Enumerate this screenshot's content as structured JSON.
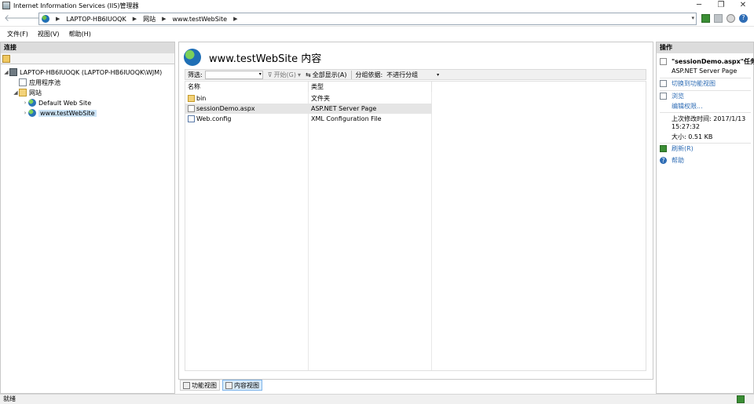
{
  "window": {
    "title": "Internet Information Services (IIS)管理器",
    "min": "─",
    "max": "❐",
    "close": "✕"
  },
  "nav": {
    "back": "🡐",
    "forward": "🡒"
  },
  "address": {
    "crumbs": [
      "LAPTOP-HB6IUOQK",
      "网站",
      "www.testWebSite"
    ],
    "sep": "▶",
    "dropdown": "▾"
  },
  "menu": [
    "文件(F)",
    "视图(V)",
    "帮助(H)"
  ],
  "connections": {
    "header": "连接",
    "tree": {
      "server": "LAPTOP-HB6IUOQK (LAPTOP-HB6IUOQK\\WJM)",
      "app_pools": "应用程序池",
      "sites": "网站",
      "site1": "Default Web Site",
      "site2": "www.testWebSite"
    }
  },
  "content": {
    "title": "www.testWebSite 内容",
    "filter_label": "筛选:",
    "start_btn": "开始(G)",
    "show_all_btn": "全部显示(A)",
    "group_label": "分组依据:",
    "group_value": "不进行分组",
    "columns": [
      "名称",
      "类型"
    ],
    "rows": [
      {
        "name": "bin",
        "type": "文件夹",
        "icon": "folder-icon"
      },
      {
        "name": "sessionDemo.aspx",
        "type": "ASP.NET Server Page",
        "icon": "page-icon"
      },
      {
        "name": "Web.config",
        "type": "XML Configuration File",
        "icon": "config-icon"
      }
    ]
  },
  "views": {
    "features": "功能视图",
    "content": "内容视图"
  },
  "actions": {
    "header": "操作",
    "task_title": "\"sessionDemo.aspx\"任务",
    "task_sub": "ASP.NET Server Page",
    "switch_features": "切换到功能视图",
    "browse": "浏览",
    "edit_perms": "编辑权限...",
    "modified_label": "上次修改时间: 2017/1/13",
    "modified_time": "15:27:32",
    "size": "大小: 0.51 KB",
    "refresh": "刷新(R)",
    "help": "帮助"
  },
  "status": {
    "text": "就绪"
  }
}
